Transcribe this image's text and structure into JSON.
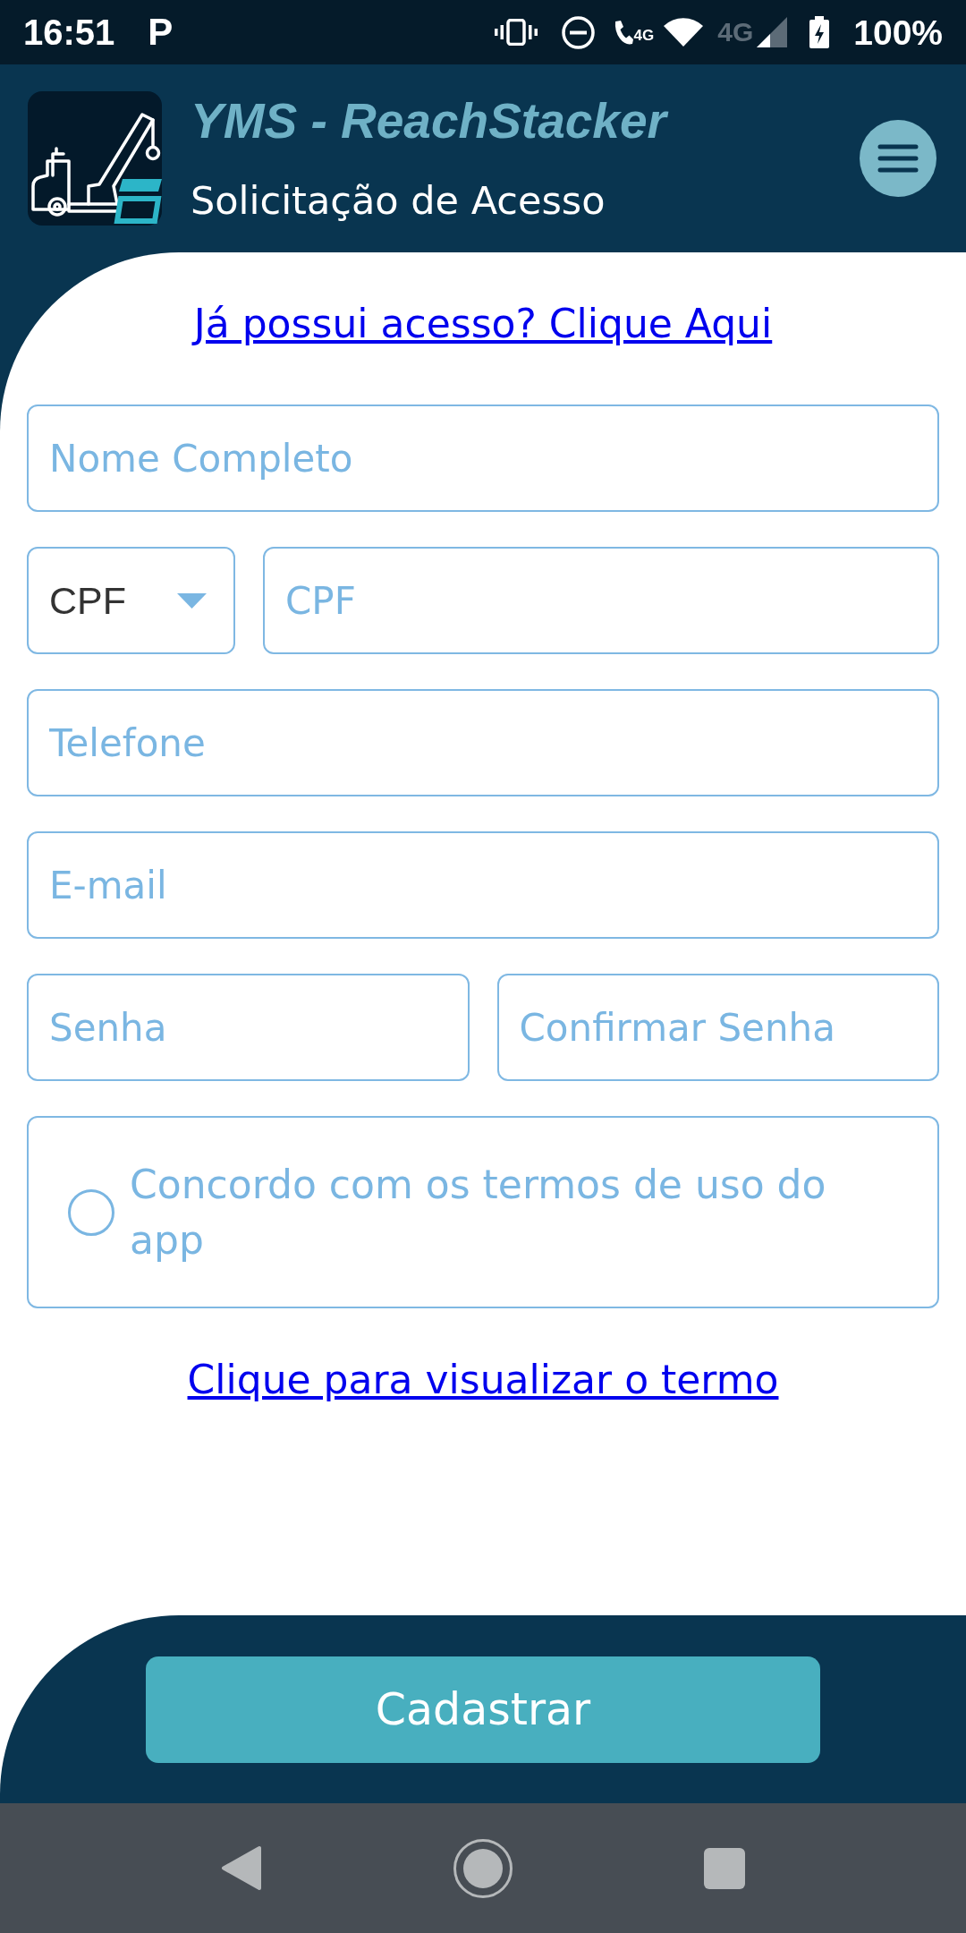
{
  "status_bar": {
    "time": "16:51",
    "notification_glyph": "P",
    "call_network": "4G",
    "mobile_network": "4G",
    "battery": "100%"
  },
  "header": {
    "title": "YMS - ReachStacker",
    "subtitle": "Solicitação de Acesso"
  },
  "login_link": "Já possui acesso? Clique Aqui",
  "form_rows": [
    {
      "fields": [
        {
          "kind": "input",
          "placeholder": "Nome Completo"
        }
      ]
    },
    {
      "fields": [
        {
          "kind": "select",
          "value": "CPF"
        },
        {
          "kind": "input",
          "placeholder": "CPF"
        }
      ]
    },
    {
      "fields": [
        {
          "kind": "input",
          "placeholder": "Telefone"
        }
      ]
    },
    {
      "fields": [
        {
          "kind": "input",
          "placeholder": "E-mail"
        }
      ]
    },
    {
      "fields": [
        {
          "kind": "input",
          "placeholder": "Senha"
        },
        {
          "kind": "input",
          "placeholder": "Confirmar Senha"
        }
      ]
    }
  ],
  "terms": {
    "label": "Concordo com os termos de uso do app",
    "checked": false
  },
  "terms_link": "Clique para visualizar o termo",
  "submit_button": "Cadastrar"
}
